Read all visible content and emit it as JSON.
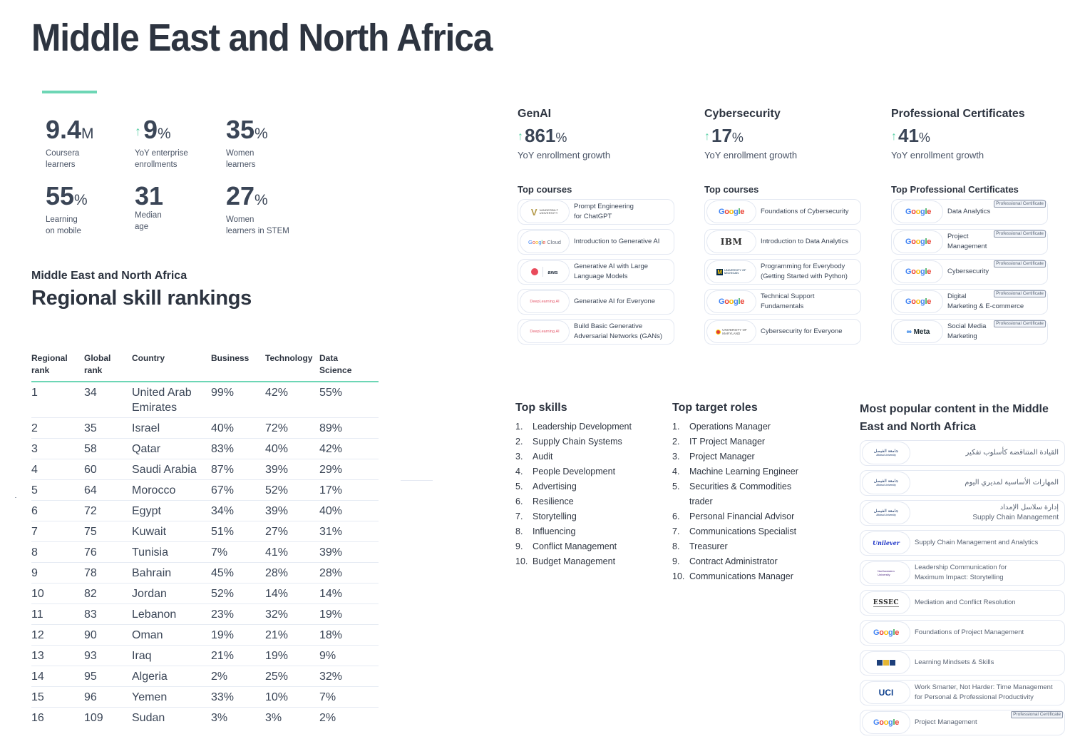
{
  "page": {
    "title": "Middle East and North Africa"
  },
  "stats": [
    {
      "value": "9.4",
      "unit": "M",
      "arrow": false,
      "label": "Coursera\nlearners"
    },
    {
      "value": "9",
      "unit": "%",
      "arrow": true,
      "label": "YoY enterprise\nenrollments"
    },
    {
      "value": "35",
      "unit": "%",
      "arrow": false,
      "label": "Women\nlearners"
    },
    {
      "value": "55",
      "unit": "%",
      "arrow": false,
      "label": "Learning\non mobile"
    },
    {
      "value": "31",
      "unit": "",
      "arrow": false,
      "label": "Median\nage"
    },
    {
      "value": "27",
      "unit": "%",
      "arrow": false,
      "label": "Women\nlearners in STEM"
    }
  ],
  "icons": {
    "up_arrow": "↑"
  },
  "rankings": {
    "subtitle": "Middle East and North Africa",
    "title": "Regional skill rankings",
    "headers": [
      "Regional\nrank",
      "Global\nrank",
      "Country",
      "Business",
      "Technology",
      "Data\nScience"
    ],
    "rows": [
      [
        "1",
        "34",
        "United Arab Emirates",
        "99%",
        "42%",
        "55%"
      ],
      [
        "2",
        "35",
        "Israel",
        "40%",
        "72%",
        "89%"
      ],
      [
        "3",
        "58",
        "Qatar",
        "83%",
        "40%",
        "42%"
      ],
      [
        "4",
        "60",
        "Saudi Arabia",
        "87%",
        "39%",
        "29%"
      ],
      [
        "5",
        "64",
        "Morocco",
        "67%",
        "52%",
        "17%"
      ],
      [
        "6",
        "72",
        "Egypt",
        "34%",
        "39%",
        "40%"
      ],
      [
        "7",
        "75",
        "Kuwait",
        "51%",
        "27%",
        "31%"
      ],
      [
        "8",
        "76",
        "Tunisia",
        "7%",
        "41%",
        "39%"
      ],
      [
        "9",
        "78",
        "Bahrain",
        "45%",
        "28%",
        "28%"
      ],
      [
        "10",
        "82",
        "Jordan",
        "52%",
        "14%",
        "14%"
      ],
      [
        "11",
        "83",
        "Lebanon",
        "23%",
        "32%",
        "19%"
      ],
      [
        "12",
        "90",
        "Oman",
        "19%",
        "21%",
        "18%"
      ],
      [
        "13",
        "93",
        "Iraq",
        "21%",
        "19%",
        "9%"
      ],
      [
        "14",
        "95",
        "Algeria",
        "2%",
        "25%",
        "32%"
      ],
      [
        "15",
        "96",
        "Yemen",
        "33%",
        "10%",
        "7%"
      ],
      [
        "16",
        "109",
        "Sudan",
        "3%",
        "3%",
        "2%"
      ]
    ]
  },
  "categories": [
    {
      "title": "GenAI",
      "value": "861",
      "unit": "%",
      "label": "YoY enrollment growth",
      "list_title": "Top courses",
      "courses": [
        {
          "logo": "vanderbilt-logo",
          "logo_text": "VANDERBILT UNIVERSITY",
          "title": "Prompt Engineering\nfor ChatGPT"
        },
        {
          "logo": "google-cloud-logo",
          "logo_text": "Google Cloud",
          "title": "Introduction to Generative AI"
        },
        {
          "logo": "deeplearning-aws-logo",
          "logo_text": "aws",
          "title": "Generative AI with Large\nLanguage Models"
        },
        {
          "logo": "deeplearning-ai-logo",
          "logo_text": "DeepLearning.AI",
          "title": "Generative AI for Everyone"
        },
        {
          "logo": "deeplearning-ai-logo",
          "logo_text": "DeepLearning.AI",
          "title": "Build Basic Generative\nAdversarial Networks (GANs)"
        }
      ]
    },
    {
      "title": "Cybersecurity",
      "value": "17",
      "unit": "%",
      "label": "YoY enrollment growth",
      "list_title": "Top courses",
      "courses": [
        {
          "logo": "google-logo",
          "logo_text": "Google",
          "title": "Foundations of Cybersecurity"
        },
        {
          "logo": "ibm-logo",
          "logo_text": "IBM",
          "title": "Introduction to Data Analytics"
        },
        {
          "logo": "umich-logo",
          "logo_text": "UNIVERSITY OF MICHIGAN",
          "title": "Programming for Everybody\n(Getting Started with Python)"
        },
        {
          "logo": "google-logo",
          "logo_text": "Google",
          "title": "Technical Support\nFundamentals"
        },
        {
          "logo": "umd-logo",
          "logo_text": "UNIVERSITY OF MARYLAND",
          "title": "Cybersecurity for Everyone"
        }
      ]
    },
    {
      "title": "Professional Certificates",
      "value": "41",
      "unit": "%",
      "label": "YoY enrollment growth",
      "list_title": "Top Professional Certificates",
      "badge": "Professional Certificate",
      "courses": [
        {
          "logo": "google-logo",
          "logo_text": "Google",
          "title": "Data Analytics"
        },
        {
          "logo": "google-logo",
          "logo_text": "Google",
          "title": "Project\nManagement"
        },
        {
          "logo": "google-logo",
          "logo_text": "Google",
          "title": "Cybersecurity"
        },
        {
          "logo": "google-logo",
          "logo_text": "Google",
          "title": "Digital\nMarketing & E-commerce"
        },
        {
          "logo": "meta-logo",
          "logo_text": "Meta",
          "title": "Social Media\nMarketing"
        }
      ]
    }
  ],
  "top_skills": {
    "title": "Top skills",
    "items": [
      "Leadership Development",
      "Supply Chain Systems",
      "Audit",
      "People Development",
      "Advertising",
      "Resilience",
      "Storytelling",
      "Influencing",
      "Conflict Management",
      "Budget Management"
    ]
  },
  "top_roles": {
    "title": "Top target roles",
    "items": [
      "Operations Manager",
      "IT Project Manager",
      "Project Manager",
      "Machine Learning Engineer",
      "Securities & Commodities trader",
      "Personal Financial Advisor",
      "Communications Specialist",
      "Treasurer",
      "Contract Administrator",
      "Communications Manager"
    ]
  },
  "popular": {
    "title": "Most popular content in the Middle East and North Africa",
    "badge": "Professional Certificate",
    "items": [
      {
        "logo": "alfaisal-logo",
        "logo_text": "جامعة الفيصل",
        "logo_sub": "Alfaisal University",
        "title": "القيادة المتناقضة كأسلوب تفكير",
        "rtl": true
      },
      {
        "logo": "alfaisal-logo",
        "logo_text": "جامعة الفيصل",
        "logo_sub": "Alfaisal University",
        "title": "المهارات الأساسية لمديري اليوم",
        "rtl": true
      },
      {
        "logo": "alfaisal-logo",
        "logo_text": "جامعة الفيصل",
        "logo_sub": "Alfaisal University",
        "title": "إدارة سلاسل الإمداد\nSupply Chain Management",
        "rtl": true
      },
      {
        "logo": "unilever-logo",
        "logo_text": "Unilever",
        "title": "Supply Chain Management and Analytics"
      },
      {
        "logo": "northwestern-logo",
        "logo_text": "Northwestern\nUniversity",
        "title": "Leadership Communication for\nMaximum Impact: Storytelling"
      },
      {
        "logo": "essec-logo",
        "logo_text": "ESSEC",
        "title": "Mediation and Conflict Resolution"
      },
      {
        "logo": "google-logo",
        "logo_text": "Google",
        "title": "Foundations of Project Management"
      },
      {
        "logo": "ktk-logo",
        "logo_text": "",
        "title": "Learning Mindsets & Skills"
      },
      {
        "logo": "uci-logo",
        "logo_text": "UCI",
        "title": "Work Smarter, Not Harder: Time Management\nfor Personal & Professional Productivity"
      },
      {
        "logo": "google-logo",
        "logo_text": "Google",
        "title": "Project Management",
        "badge": true
      }
    ]
  }
}
